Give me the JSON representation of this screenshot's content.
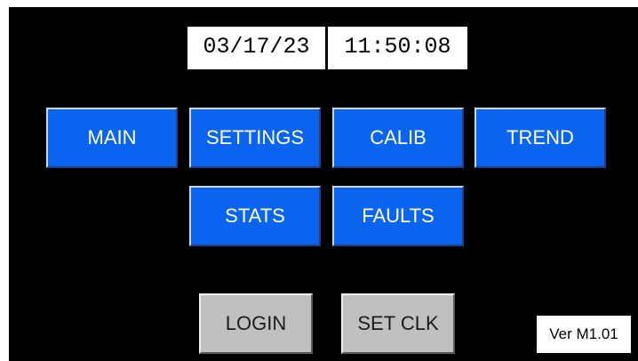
{
  "clock": {
    "date": "03/17/23",
    "time": "11:50:08"
  },
  "menu": {
    "row1": [
      "MAIN",
      "SETTINGS",
      "CALIB",
      "TREND"
    ],
    "row2": [
      "STATS",
      "FAULTS"
    ]
  },
  "actions": {
    "login_label": "LOGIN",
    "set_clock_label": "SET CLK"
  },
  "version_label": "Ver M1.01",
  "colors": {
    "background": "#000000",
    "menu_button": "#0a64f0",
    "menu_text": "#ffffff",
    "action_button": "#c0c0c0",
    "field_background": "#ffffff"
  }
}
